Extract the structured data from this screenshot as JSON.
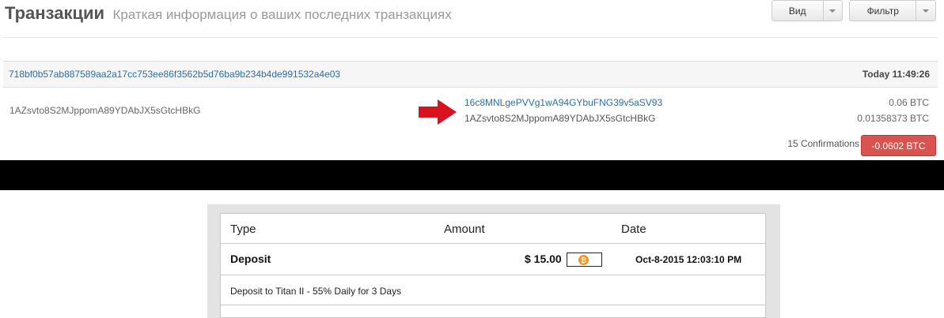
{
  "header": {
    "title": "Транзакции",
    "subtitle": "Краткая информация о ваших последних транзакциях",
    "view_button": "Вид",
    "filter_button": "Фильтр"
  },
  "transaction": {
    "hash": "718bf0b57ab887589aa2a17cc753ee86f3562b5d76ba9b234b4de991532a4e03",
    "time": "Today 11:49:26",
    "from_address": "1AZsvto8S2MJppomA89YDAbJX5sGtcHBkG",
    "outputs": [
      {
        "address": "16c8MNLgePVVg1wA94GYbuFNG39v5aSV93",
        "amount": "0.06 BTC"
      },
      {
        "address": "1AZsvto8S2MJppomA89YDAbJX5sGtcHBkG",
        "amount": "0.01358373 BTC"
      }
    ],
    "confirmations": "15 Confirmations",
    "total": "-0.0602 BTC"
  },
  "history": {
    "columns": {
      "type": "Type",
      "amount": "Amount",
      "date": "Date"
    },
    "rows": [
      {
        "type": "Deposit",
        "amount": "$ 15.00",
        "currency_icon": "bitcoin-icon",
        "date": "Oct-8-2015 12:03:10 PM",
        "description": "Deposit to Titan II - 55% Daily for 3 Days"
      }
    ]
  },
  "colors": {
    "link": "#2a6ea6",
    "danger": "#d9534f",
    "bitcoin": "#f7931a"
  }
}
